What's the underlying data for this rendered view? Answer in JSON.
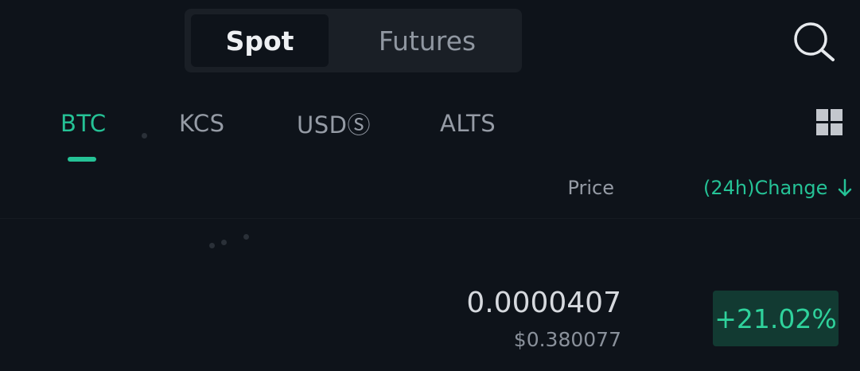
{
  "market_type_tabs": {
    "spot_label": "Spot",
    "futures_label": "Futures",
    "selected": "Spot"
  },
  "header": {
    "search_icon": "search-icon"
  },
  "category_tabs": {
    "items": [
      {
        "label": "BTC",
        "selected": true
      },
      {
        "label": "KCS",
        "selected": false
      },
      {
        "label": "USDⓈ",
        "selected": false
      },
      {
        "label": "ALTS",
        "selected": false
      }
    ],
    "layout_toggle_icon": "grid-icon"
  },
  "columns": {
    "price_label": "Price",
    "change_label": "(24h)Change",
    "change_sort_icon": "arrow-down-icon"
  },
  "rows": [
    {
      "price": "0.0000407",
      "fiat_price": "$0.380077",
      "change": "+21.02%"
    }
  ],
  "colors": {
    "background": "#0e131a",
    "accent_green": "#25c296",
    "positive_badge_bg": "#123a32",
    "positive_text": "#2fd29c"
  }
}
